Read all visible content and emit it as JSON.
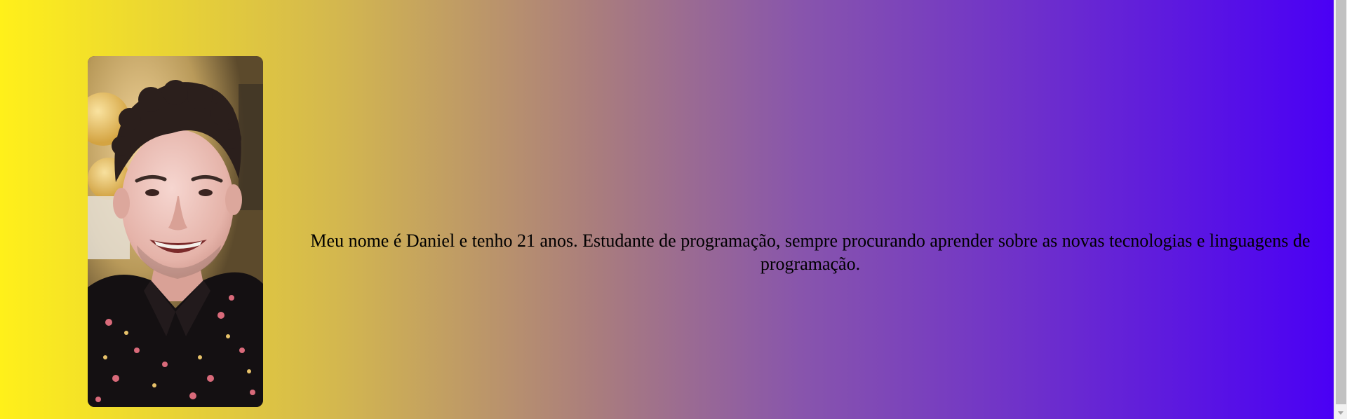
{
  "profile": {
    "photo_alt": "Foto de Daniel",
    "bio": "Meu nome é Daniel e tenho 21 anos. Estudante de programação, sempre procurando aprender sobre as novas tecnologias e linguagens de programação."
  },
  "colors": {
    "gradient_start": "#fff01a",
    "gradient_end": "#4a00f5",
    "text": "#000000"
  }
}
